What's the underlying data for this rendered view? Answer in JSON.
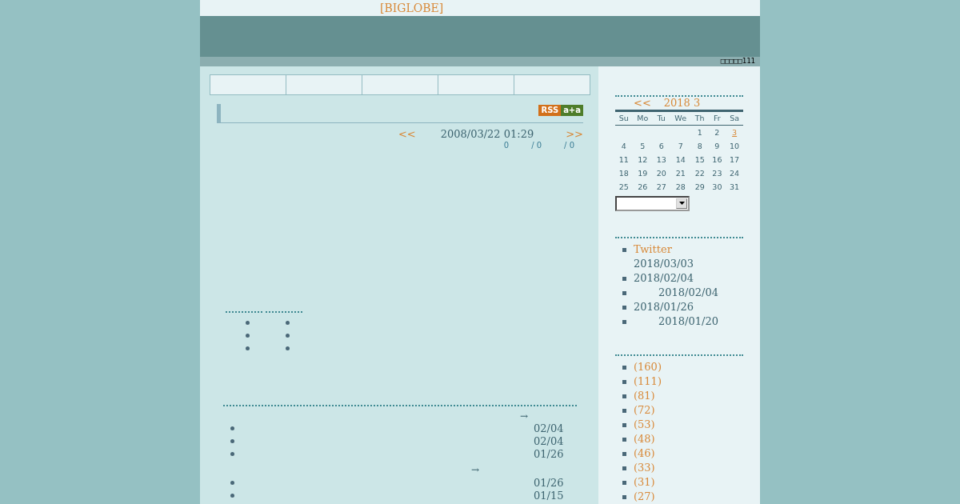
{
  "header": {
    "site_link": "[BIGLOBE]",
    "counter": "□□□□□111"
  },
  "nav_tabs": [
    {
      "kind": "tab"
    },
    {
      "kind": "tab"
    },
    {
      "kind": "tab"
    },
    {
      "kind": "tab"
    },
    {
      "kind": "tab"
    }
  ],
  "entry": {
    "rss_badge": {
      "label": "RSS",
      "second": "a+a"
    },
    "prev": "<<",
    "datetime": "2008/03/22 01:29",
    "next": ">>",
    "counts": [
      "0",
      "/ 0",
      "/ 0"
    ]
  },
  "link_columns": [
    {
      "items": [
        {
          "kind": "bullet"
        },
        {
          "kind": "bullet"
        },
        {
          "kind": "bullet"
        }
      ]
    },
    {
      "items": [
        {
          "kind": "bullet"
        },
        {
          "kind": "bullet"
        },
        {
          "kind": "bullet"
        }
      ]
    }
  ],
  "recent_groups": [
    {
      "arrow": "→",
      "rows": [
        "02/04",
        "02/04",
        "01/26"
      ]
    },
    {
      "arrow": "→",
      "rows": [
        "01/26",
        "01/15"
      ]
    }
  ],
  "calendar": {
    "prev": "<<",
    "title": "2018 3",
    "weekdays": [
      "Su",
      "Mo",
      "Tu",
      "We",
      "Th",
      "Fr",
      "Sa"
    ],
    "weeks": [
      [
        {
          "kind": "blank"
        },
        {
          "kind": "blank"
        },
        {
          "kind": "blank"
        },
        {
          "kind": "blank"
        },
        {
          "d": "1",
          "link": false
        },
        {
          "d": "2",
          "link": false
        },
        {
          "d": "3",
          "link": true
        }
      ],
      [
        {
          "d": "4",
          "link": false
        },
        {
          "d": "5",
          "link": false
        },
        {
          "d": "6",
          "link": false
        },
        {
          "d": "7",
          "link": false
        },
        {
          "d": "8",
          "link": false
        },
        {
          "d": "9",
          "link": false
        },
        {
          "d": "10",
          "link": false
        }
      ],
      [
        {
          "d": "11",
          "link": false
        },
        {
          "d": "12",
          "link": false
        },
        {
          "d": "13",
          "link": false
        },
        {
          "d": "14",
          "link": false
        },
        {
          "d": "15",
          "link": false
        },
        {
          "d": "16",
          "link": false
        },
        {
          "d": "17",
          "link": false
        }
      ],
      [
        {
          "d": "18",
          "link": false
        },
        {
          "d": "19",
          "link": false
        },
        {
          "d": "20",
          "link": false
        },
        {
          "d": "21",
          "link": false
        },
        {
          "d": "22",
          "link": false
        },
        {
          "d": "23",
          "link": false
        },
        {
          "d": "24",
          "link": false
        }
      ],
      [
        {
          "d": "25",
          "link": false
        },
        {
          "d": "26",
          "link": false
        },
        {
          "d": "27",
          "link": false
        },
        {
          "d": "28",
          "link": false
        },
        {
          "d": "29",
          "link": false
        },
        {
          "d": "30",
          "link": false
        },
        {
          "d": "31",
          "link": false
        }
      ]
    ]
  },
  "archives": [
    {
      "kind": "plain",
      "title": "Twitter",
      "date": "2018/03/03"
    },
    {
      "kind": "plain",
      "date": "2018/02/04"
    },
    {
      "kind": "indented",
      "date": "2018/02/04"
    },
    {
      "kind": "plain",
      "date": "2018/01/26"
    },
    {
      "kind": "indented",
      "date": "2018/01/20"
    }
  ],
  "categories": [
    "(160)",
    "(111)",
    "(81)",
    "(72)",
    "(53)",
    "(48)",
    "(46)",
    "(33)",
    "(31)",
    "(27)"
  ]
}
